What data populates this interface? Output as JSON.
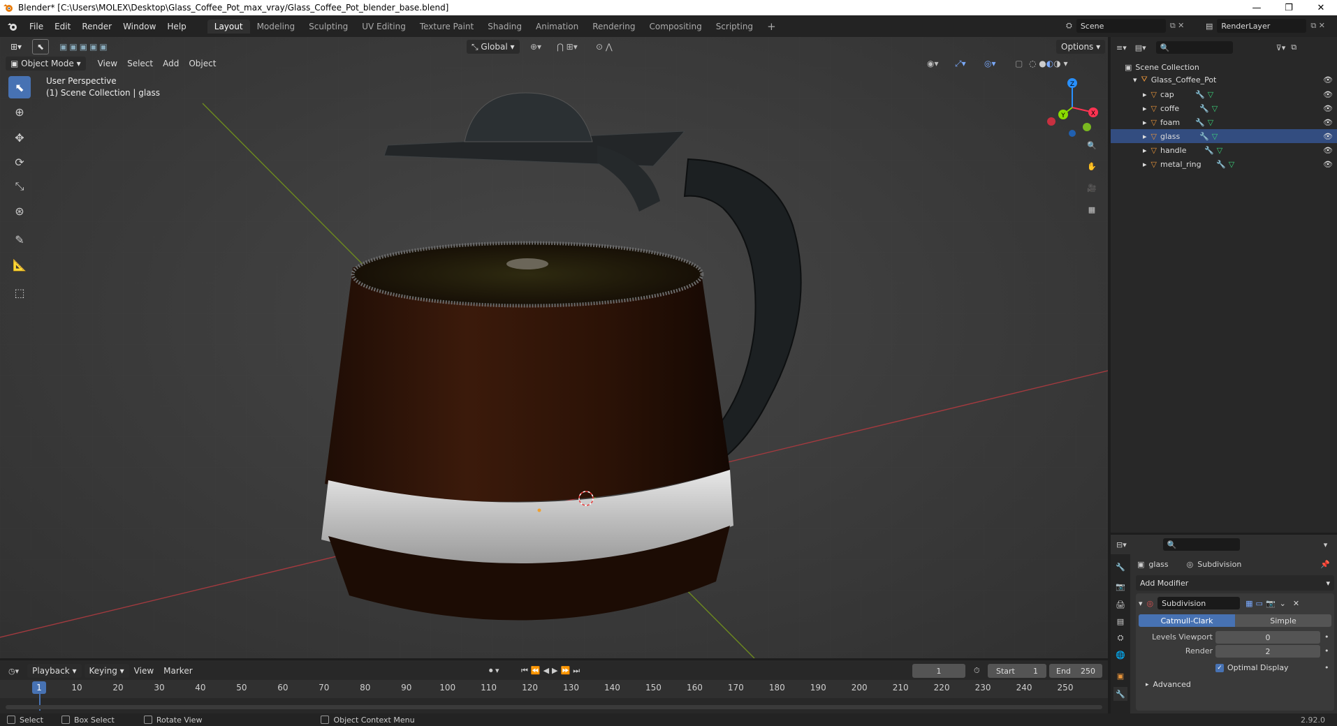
{
  "window": {
    "title": "Blender* [C:\\Users\\MOLEX\\Desktop\\Glass_Coffee_Pot_max_vray/Glass_Coffee_Pot_blender_base.blend]"
  },
  "menu": [
    "File",
    "Edit",
    "Render",
    "Window",
    "Help"
  ],
  "workspaces": [
    "Layout",
    "Modeling",
    "Sculpting",
    "UV Editing",
    "Texture Paint",
    "Shading",
    "Animation",
    "Rendering",
    "Compositing",
    "Scripting"
  ],
  "active_workspace": "Layout",
  "scene": "Scene",
  "render_layer": "RenderLayer",
  "viewport": {
    "transform_orientation": "Global",
    "options_label": "Options",
    "mode": "Object Mode",
    "header_menus": [
      "View",
      "Select",
      "Add",
      "Object"
    ],
    "overlay_line1": "User Perspective",
    "overlay_line2": "(1) Scene Collection | glass",
    "gizmo_axes": [
      "X",
      "Y",
      "Z"
    ]
  },
  "outliner": {
    "root": "Scene Collection",
    "collection": "Glass_Coffee_Pot",
    "objects": [
      "cap",
      "coffe",
      "foam",
      "glass",
      "handle",
      "metal_ring"
    ]
  },
  "properties": {
    "object": "glass",
    "modifier_tab": "Subdivision",
    "add_modifier": "Add Modifier",
    "modifier_name": "Subdivision",
    "types": [
      "Catmull-Clark",
      "Simple"
    ],
    "active_type": "Catmull-Clark",
    "levels_viewport_label": "Levels Viewport",
    "levels_viewport": "0",
    "render_label": "Render",
    "render_value": "2",
    "optimal_display": "Optimal Display",
    "advanced": "Advanced"
  },
  "timeline": {
    "menus": [
      "Playback",
      "Keying",
      "View",
      "Marker"
    ],
    "current_frame": "1",
    "start_label": "Start",
    "start": "1",
    "end_label": "End",
    "end": "250",
    "ticks": [
      "10",
      "20",
      "30",
      "40",
      "50",
      "60",
      "70",
      "80",
      "90",
      "100",
      "110",
      "120",
      "130",
      "140",
      "150",
      "160",
      "170",
      "180",
      "190",
      "200",
      "210",
      "220",
      "230",
      "240",
      "250"
    ],
    "playhead": "1"
  },
  "statusbar": {
    "select": "Select",
    "box_select": "Box Select",
    "rotate_view": "Rotate View",
    "context_menu": "Object Context Menu",
    "version": "2.92.0"
  },
  "colors": {
    "accent": "#4772b3",
    "x_axis": "#ff3352",
    "y_axis": "#8bdc00",
    "z_axis": "#2890ff",
    "object_orange": "#e8943a"
  }
}
